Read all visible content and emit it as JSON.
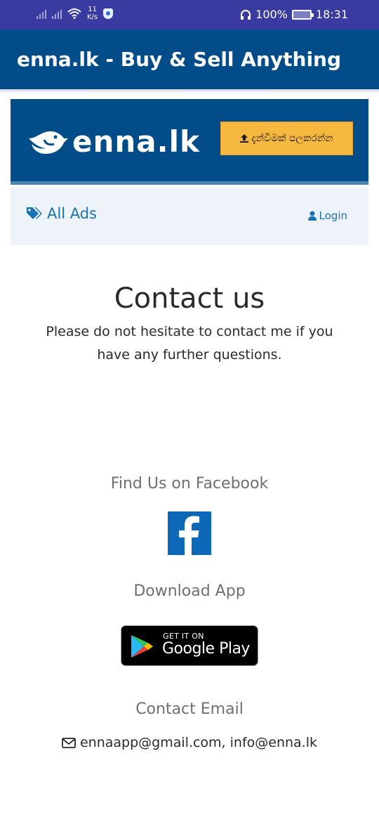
{
  "status_bar": {
    "net_speed_value": "11",
    "net_speed_unit": "K/s",
    "battery": "100%",
    "time": "18:31"
  },
  "app_bar": {
    "title": "enna.lk - Buy & Sell Anything"
  },
  "site_header": {
    "logo_text": "enna.lk",
    "post_ad_label": "දැන්වීමක් පලකරන්න"
  },
  "nav": {
    "all_ads_label": "All Ads",
    "login_label": "Login"
  },
  "content": {
    "title": "Contact us",
    "subtitle": "Please do not hesitate to contact me if you have any further questions.",
    "facebook_heading": "Find Us on Facebook",
    "download_heading": "Download App",
    "google_play_small": "GET IT ON",
    "google_play_big": "Google Play",
    "email_heading": "Contact Email",
    "email_text": "ennaapp@gmail.com, info@enna.lk"
  },
  "colors": {
    "status_bar": "#3a3ba0",
    "app_bar": "#024c89",
    "post_ad_button": "#f6b83f",
    "link_blue": "#1a72b6",
    "facebook_blue": "#0e68b8"
  }
}
